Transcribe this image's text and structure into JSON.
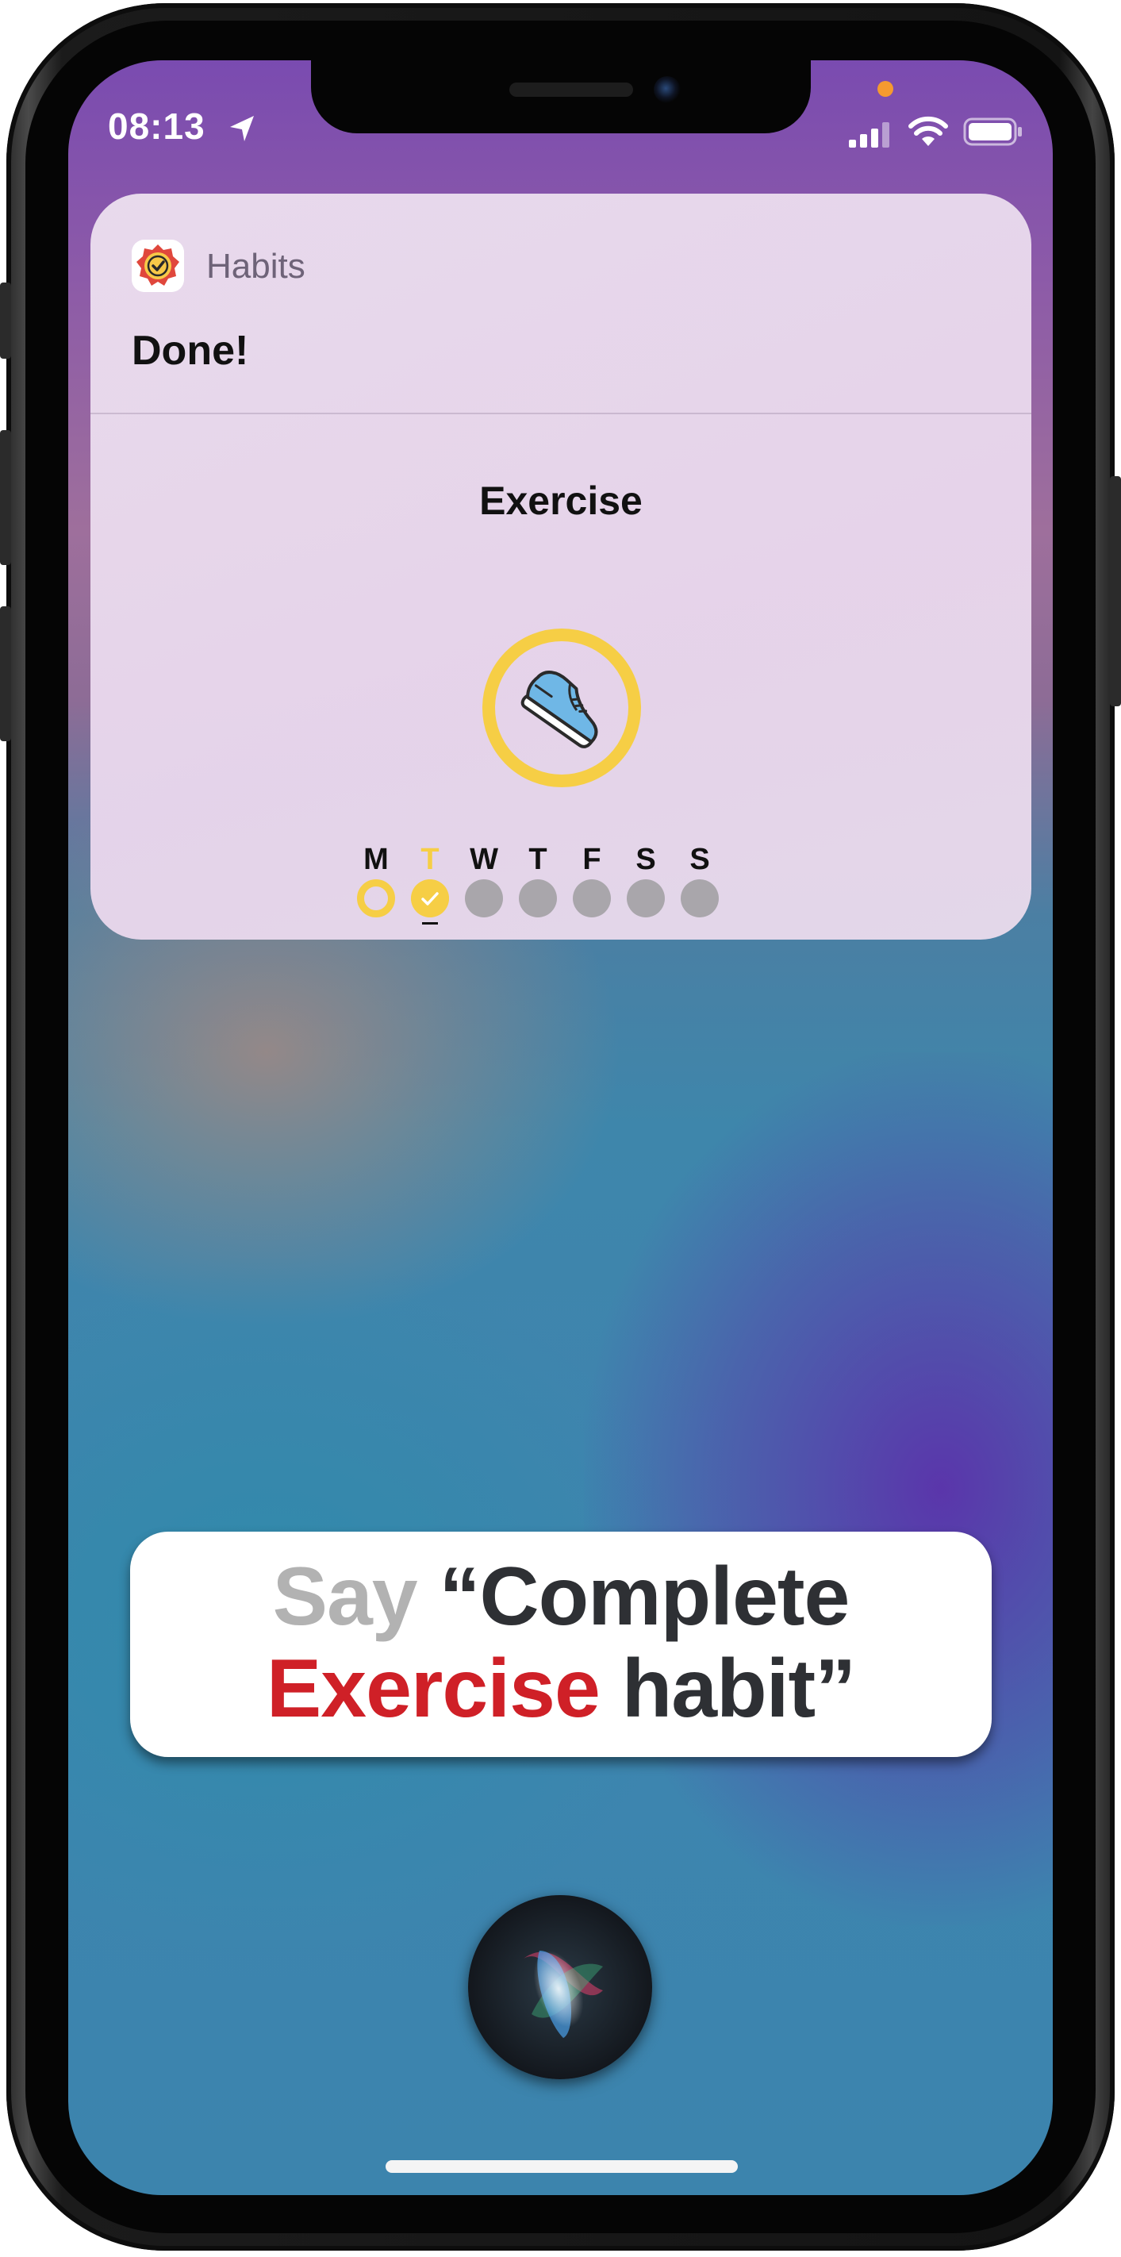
{
  "status_bar": {
    "time": "08:13",
    "location_icon": "location-arrow-icon",
    "signal_icon": "cellular-signal-icon",
    "wifi_icon": "wifi-icon",
    "battery_icon": "battery-icon",
    "privacy_indicator_color": "#f59a2f"
  },
  "siri_card": {
    "app_icon": "habits-app-icon",
    "app_name": "Habits",
    "response": "Done!",
    "habit": {
      "title": "Exercise",
      "icon": "sneaker-icon",
      "ring_color": "#f6ce45",
      "week": [
        {
          "letter": "M",
          "state": "in-progress"
        },
        {
          "letter": "T",
          "state": "completed",
          "today": true
        },
        {
          "letter": "W",
          "state": "empty"
        },
        {
          "letter": "T",
          "state": "empty"
        },
        {
          "letter": "F",
          "state": "empty"
        },
        {
          "letter": "S",
          "state": "empty"
        },
        {
          "letter": "S",
          "state": "empty"
        }
      ]
    }
  },
  "caption": {
    "say": "Say",
    "quote_start": "“Complete",
    "habit_name": "Exercise",
    "quote_end": "habit”",
    "colors": {
      "say": "#b2b2b2",
      "habit_name": "#cf2027",
      "text": "#2e3034"
    }
  },
  "siri": {
    "orb_icon": "siri-orb-icon"
  }
}
